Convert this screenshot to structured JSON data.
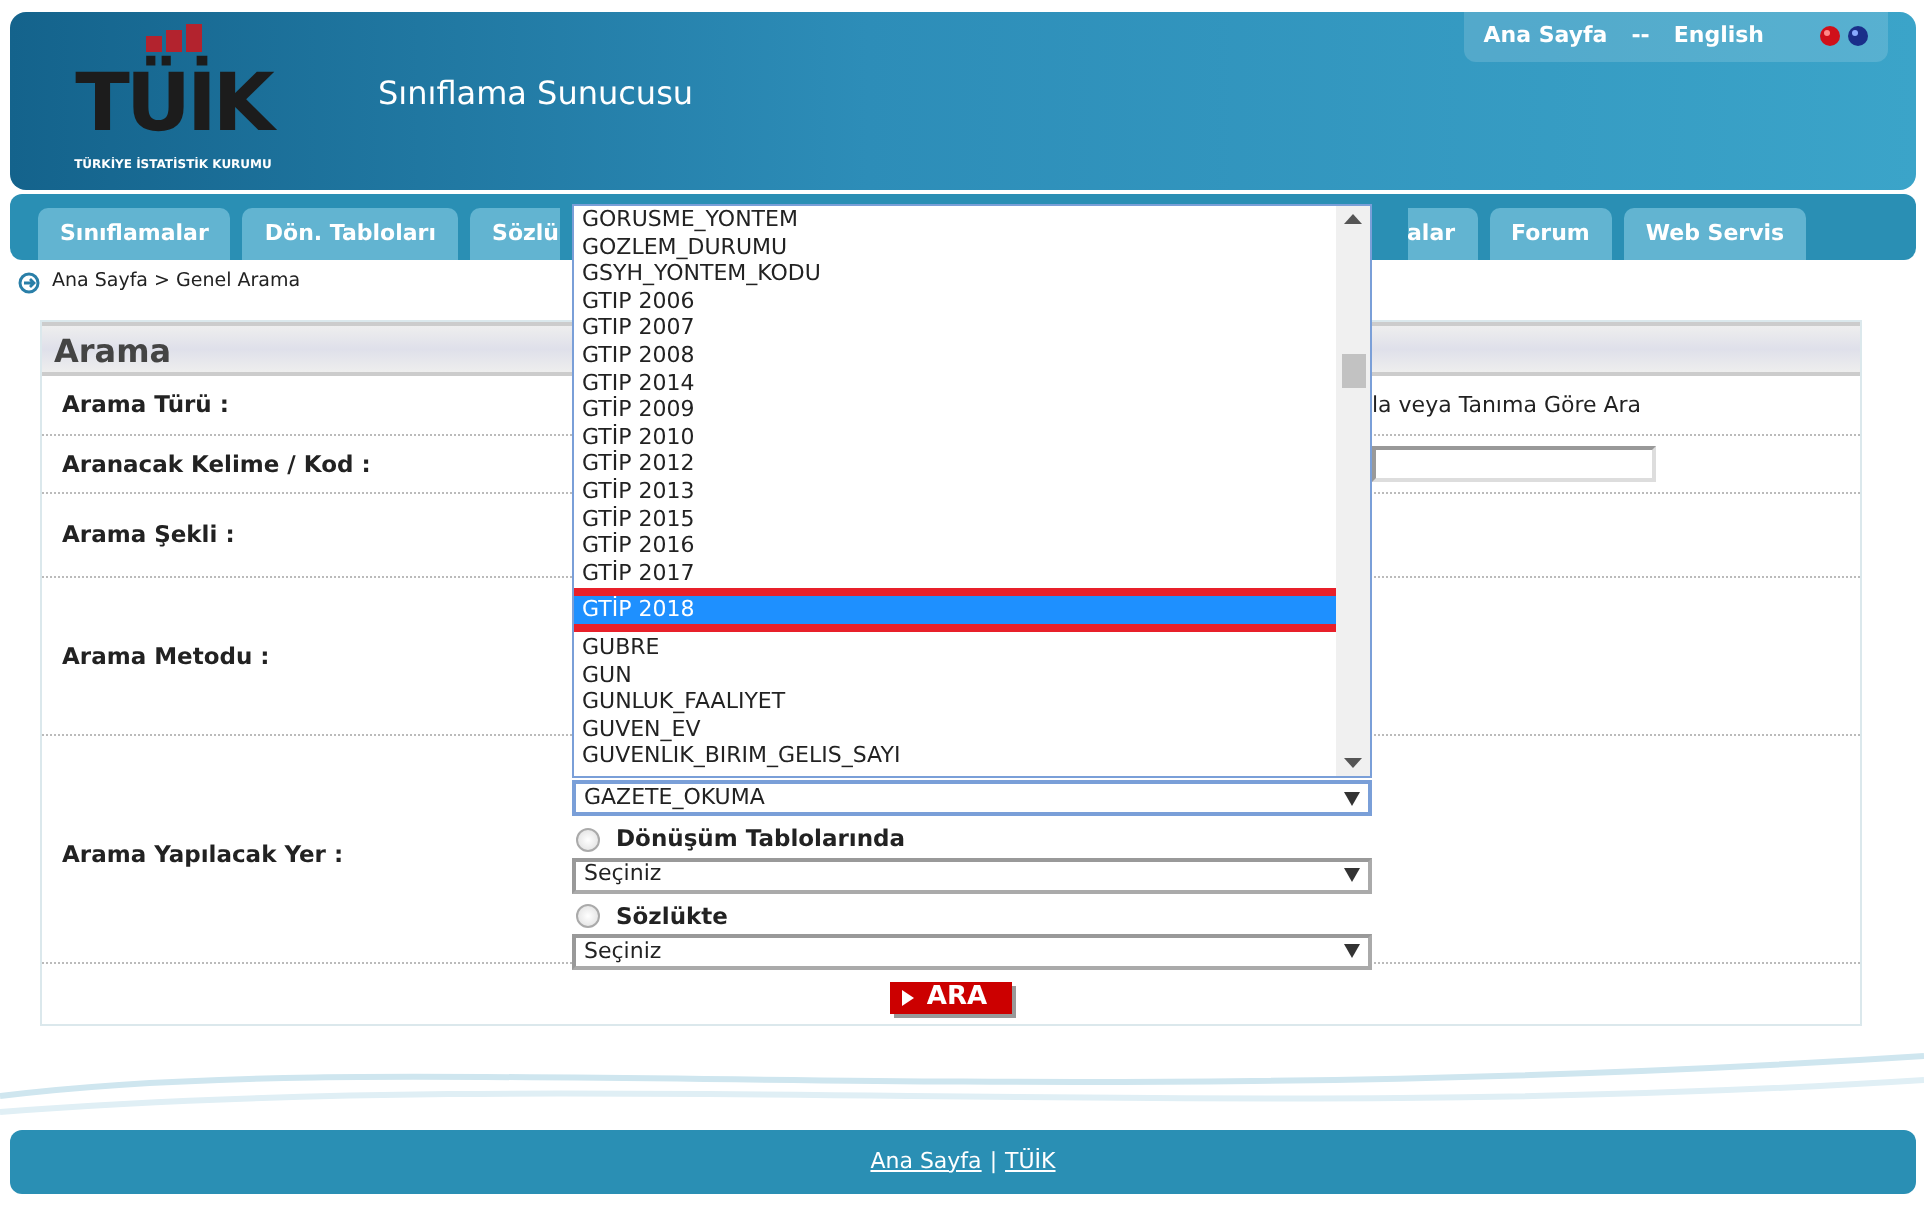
{
  "header": {
    "logo_text": "TÜİK",
    "logo_subtitle": "TÜRKİYE İSTATİSTİK KURUMU",
    "title": "Sınıflama Sunucusu",
    "top_links": [
      "Ana Sayfa",
      "English"
    ],
    "link_separator": "--"
  },
  "tabs": [
    {
      "label": "Sınıflamalar",
      "kind": "full",
      "selected": false
    },
    {
      "label": "Dön. Tabloları",
      "kind": "full",
      "selected": false
    },
    {
      "label": "Sözlü",
      "kind": "cut_right",
      "selected": false
    },
    {
      "label": "alar",
      "kind": "cut_left",
      "selected": false
    },
    {
      "label": "Forum",
      "kind": "full",
      "selected": false
    },
    {
      "label": "Web Servis",
      "kind": "full",
      "selected": false
    }
  ],
  "breadcrumb": "Ana Sayfa > Genel Arama",
  "form": {
    "title": "Arama",
    "rows": [
      {
        "label": "Arama Türü :",
        "kind": "text",
        "text": "la veya Tanıma Göre Ara"
      },
      {
        "label": "Aranacak Kelime / Kod :",
        "kind": "input"
      },
      {
        "label": "Arama Şekli :",
        "kind": "empty"
      },
      {
        "label": "Arama Metodu :",
        "kind": "empty"
      },
      {
        "label": "Arama Yapılacak Yer :",
        "kind": "places",
        "select_value": "GAZETE_OKUMA",
        "choices": [
          {
            "label": "Dönüşüm Tablolarında",
            "checked": false,
            "select_value": "Seçiniz"
          },
          {
            "label": "Sözlükte",
            "checked": false,
            "select_value": "Seçiniz"
          }
        ]
      }
    ],
    "button": "ARA"
  },
  "dropdown_list": {
    "options": [
      {
        "label": "GORUSME_YONTEM",
        "selected": false
      },
      {
        "label": "GOZLEM_DURUMU",
        "selected": false
      },
      {
        "label": "GSYH_YONTEM_KODU",
        "selected": false
      },
      {
        "label": "GTIP 2006",
        "selected": false
      },
      {
        "label": "GTIP 2007",
        "selected": false
      },
      {
        "label": "GTIP 2008",
        "selected": false
      },
      {
        "label": "GTIP 2014",
        "selected": false
      },
      {
        "label": "GTİP 2009",
        "selected": false
      },
      {
        "label": "GTİP 2010",
        "selected": false
      },
      {
        "label": "GTİP 2012",
        "selected": false
      },
      {
        "label": "GTİP 2013",
        "selected": false
      },
      {
        "label": "GTİP 2015",
        "selected": false
      },
      {
        "label": "GTİP 2016",
        "selected": false
      },
      {
        "label": "GTİP 2017",
        "selected": false
      },
      {
        "label": "GTİP 2018",
        "selected": true
      },
      {
        "label": "GUBRE",
        "selected": false
      },
      {
        "label": "GUN",
        "selected": false
      },
      {
        "label": "GUNLUK_FAALIYET",
        "selected": false
      },
      {
        "label": "GUVEN_EV",
        "selected": false
      },
      {
        "label": "GUVENLIK_BIRIM_GELIS_SAYI",
        "selected": false
      }
    ]
  },
  "footer_links": [
    "Ana Sayfa",
    "TÜİK"
  ],
  "footer_separator": "|"
}
